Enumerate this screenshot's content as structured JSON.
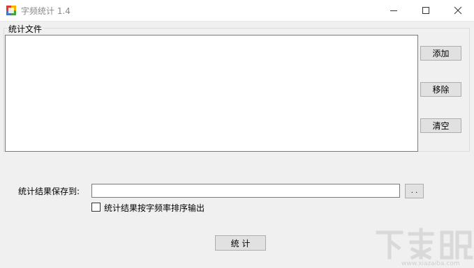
{
  "window": {
    "title": "字频统计 1.4",
    "icon": "app-icon",
    "controls": [
      "minimize-icon",
      "maximize-icon",
      "close-icon"
    ]
  },
  "files_group": {
    "label": "统计文件",
    "items": [],
    "buttons": {
      "add": "添加",
      "remove": "移除",
      "clear": "清空"
    }
  },
  "output": {
    "save_label": "统计结果保存到:",
    "path_value": "",
    "browse_label": ". .",
    "sort_checkbox_label": "统计结果按字频率排序输出",
    "sort_checked": false
  },
  "run_button": "统 计",
  "watermark": {
    "text": "下载吧",
    "url": "www.xiazaiba.com"
  },
  "colors": {
    "window_bg": "#f0f0f0",
    "button_bg": "#e1e1e1",
    "button_border": "#adadad",
    "field_border": "#7a7a7a"
  }
}
